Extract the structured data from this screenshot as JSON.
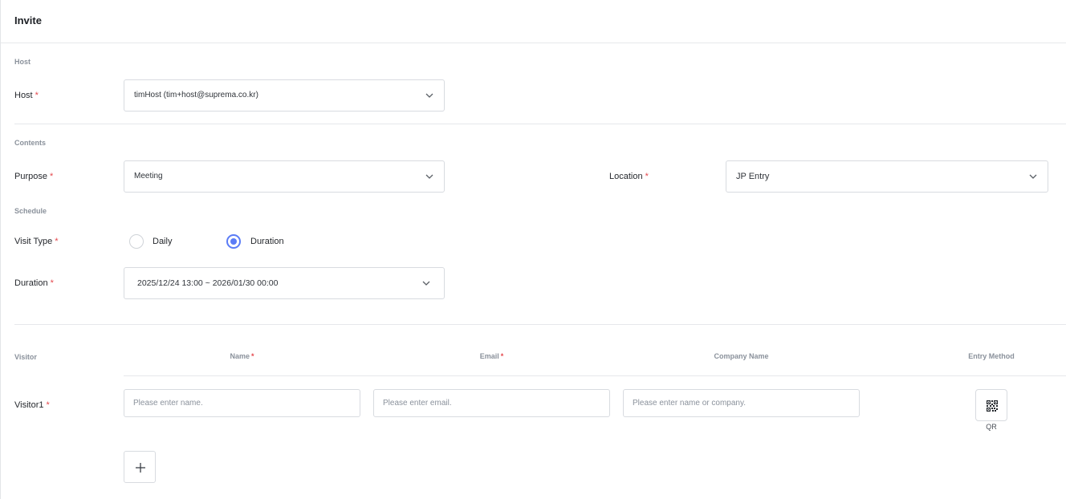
{
  "header": {
    "title": "Invite"
  },
  "sections": {
    "host": "Host",
    "contents": "Contents",
    "schedule": "Schedule",
    "visitor": "Visitor"
  },
  "host": {
    "label": "Host",
    "required": "*",
    "value": "timHost (tim+host@suprema.co.kr)"
  },
  "purpose": {
    "label": "Purpose",
    "required": "*",
    "value": "Meeting"
  },
  "location": {
    "label": "Location",
    "required": "*",
    "value": "JP Entry"
  },
  "visit_type": {
    "label": "Visit Type",
    "required": "*",
    "options": [
      "Daily",
      "Duration"
    ],
    "selected": "Duration"
  },
  "duration": {
    "label": "Duration",
    "required": "*",
    "value": "2025/12/24 13:00 ~ 2026/01/30 00:00"
  },
  "visitor_table": {
    "columns": {
      "name": "Name",
      "email": "Email",
      "company": "Company Name",
      "entry_method": "Entry Method"
    },
    "required": "*",
    "rows": [
      {
        "label": "Visitor1",
        "required": "*",
        "name_placeholder": "Please enter name.",
        "email_placeholder": "Please enter email.",
        "company_placeholder": "Please enter name or company.",
        "entry_method": "QR"
      }
    ]
  },
  "icons": {
    "chevron": "chevron-down-icon",
    "qr": "qr-code-icon",
    "add": "plus-icon"
  },
  "colors": {
    "accent": "#5b7cf6",
    "required": "#e5484d"
  }
}
